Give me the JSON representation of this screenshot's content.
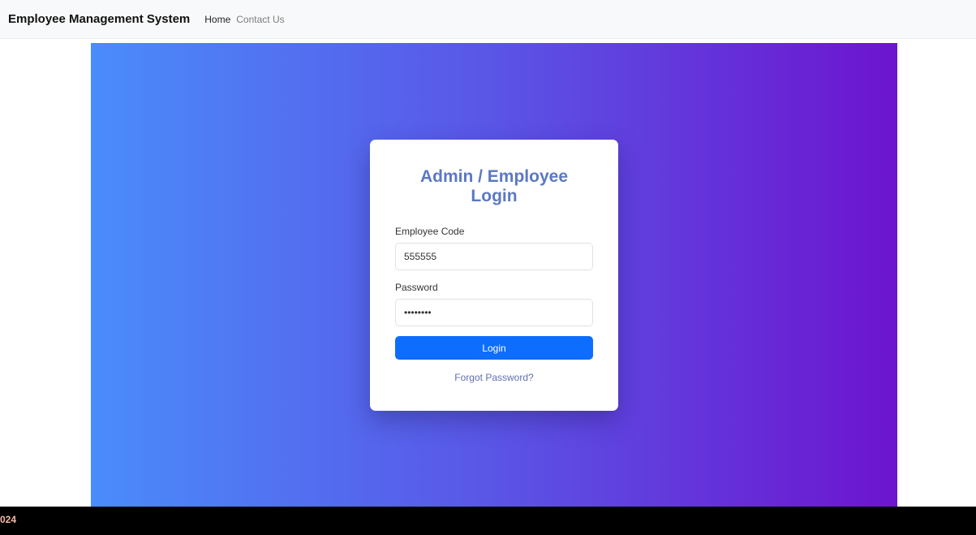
{
  "navbar": {
    "brand": "Employee Management System",
    "links": [
      {
        "label": "Home"
      },
      {
        "label": "Contact Us"
      }
    ]
  },
  "login_card": {
    "title": "Admin / Employee Login",
    "employee_code_label": "Employee Code",
    "employee_code_value": "555555",
    "password_label": "Password",
    "password_value": "secret99",
    "login_button_label": "Login",
    "forgot_password_label": "Forgot Password?"
  },
  "footer": {
    "text": "024"
  },
  "colors": {
    "gradient_start": "#4a8cfb",
    "gradient_end": "#6d14cf",
    "primary_button": "#0d6efd",
    "title": "#5b78c4"
  }
}
